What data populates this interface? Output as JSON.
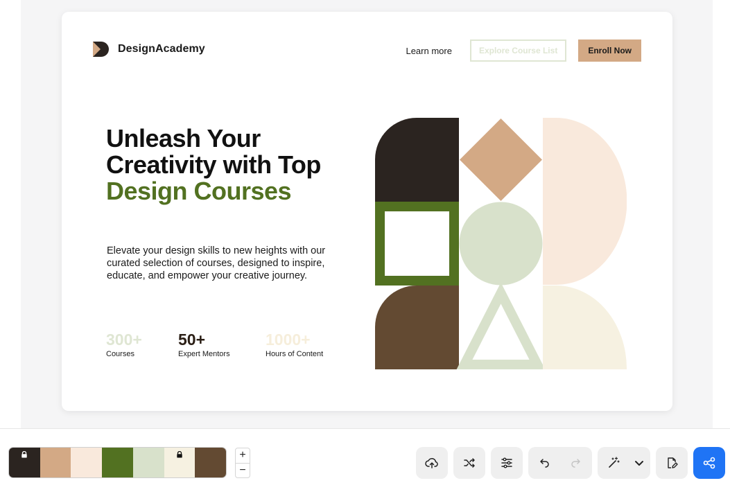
{
  "brand": {
    "name": "DesignAcademy",
    "icon": "logo-mark-icon"
  },
  "nav": {
    "learn_more": "Learn more",
    "explore_label": "Explore Course List",
    "enroll_label": "Enroll Now"
  },
  "hero": {
    "headline_part1": "Unleash Your Creativity with Top ",
    "headline_accent": "Design Courses",
    "description": "Elevate your design skills to new heights with our curated selection of courses, designed to inspire, educate, and empower your creative journey."
  },
  "stats": [
    {
      "value": "300+",
      "label": "Courses",
      "color": "#dfe6d3"
    },
    {
      "value": "50+",
      "label": "Expert Mentors",
      "color": "#2b1f16"
    },
    {
      "value": "1000+",
      "label": "Hours of Content",
      "color": "#f6eedb"
    }
  ],
  "colors": {
    "dark": "#2b2420",
    "tan": "#d3a985",
    "cream": "#f9e9dc",
    "green": "#527121",
    "sage": "#d8e1cb",
    "ivory": "#f6f1e1",
    "brown": "#634a32",
    "accent_blue": "#1f74f5"
  },
  "palette": {
    "swatches": [
      {
        "color": "#2b2420",
        "locked": true
      },
      {
        "color": "#d3a985",
        "locked": false
      },
      {
        "color": "#f9e9dc",
        "locked": false
      },
      {
        "color": "#527121",
        "locked": false
      },
      {
        "color": "#d8e1cb",
        "locked": false
      },
      {
        "color": "#f6f1e1",
        "locked": true
      },
      {
        "color": "#634a32",
        "locked": false
      }
    ]
  },
  "zoom": {
    "plus": "+",
    "minus": "−"
  },
  "toolbar": {
    "icons": [
      "upload-cloud-icon",
      "shuffle-icon",
      "sliders-icon",
      "undo-icon",
      "redo-icon",
      "magic-wand-icon",
      "chevron-down-icon",
      "edit-document-icon",
      "share-icon"
    ]
  }
}
